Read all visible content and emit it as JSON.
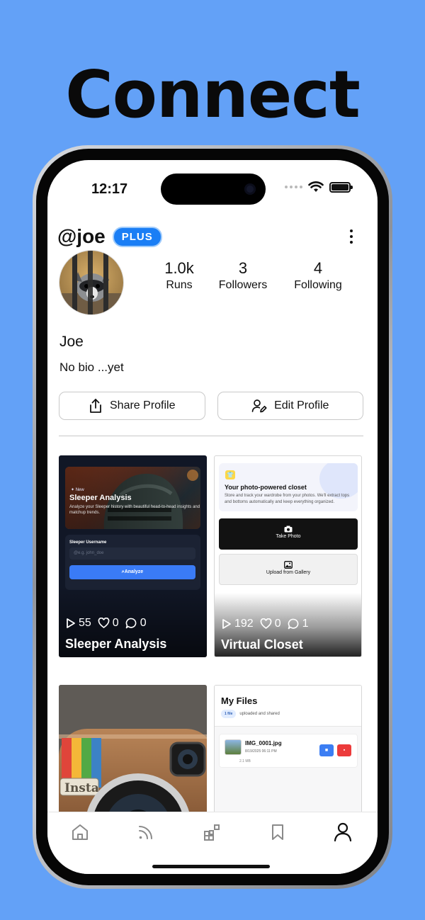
{
  "headline": "Connect",
  "status": {
    "time": "12:17"
  },
  "profile": {
    "username": "@joe",
    "badge": "PLUS",
    "display_name": "Joe",
    "bio": "No bio ...yet",
    "stats": [
      {
        "value": "1.0k",
        "label": "Runs"
      },
      {
        "value": "3",
        "label": "Followers"
      },
      {
        "value": "4",
        "label": "Following"
      }
    ],
    "share_label": "Share Profile",
    "edit_label": "Edit Profile"
  },
  "cards": [
    {
      "title": "Sleeper Analysis",
      "plays": "55",
      "likes": "0",
      "comments": "0",
      "preview": {
        "tag": "New",
        "heading": "Sleeper Analysis",
        "desc": "Analyze your Sleeper history with beautiful head-to-head insights and matchup trends.",
        "field_label": "Sleeper Username",
        "placeholder": "@e.g. john_doe",
        "button": "Analyze"
      }
    },
    {
      "title": "Virtual Closet",
      "plays": "192",
      "likes": "0",
      "comments": "1",
      "preview": {
        "heading": "Your photo-powered closet",
        "desc": "Store and track your wardrobe from your photos. We'll extract tops and bottoms automatically and keep everything organized.",
        "take_photo": "Take Photo",
        "upload": "Upload from Gallery"
      }
    },
    {
      "preview": {
        "logo_text": "Insta"
      }
    },
    {
      "preview": {
        "heading": "My Files",
        "count_badge": "1 file",
        "count_text": "uploaded and shared",
        "file_name": "IMG_0001.jpg",
        "file_date": "8/19/2025 06:11 PM",
        "file_size": "2.1 MB"
      }
    }
  ],
  "colors": {
    "background": "#63a1f7",
    "accent": "#1a7ef5"
  },
  "nav": [
    "home-icon",
    "feed-icon",
    "apps-icon",
    "bookmark-icon",
    "profile-icon"
  ]
}
